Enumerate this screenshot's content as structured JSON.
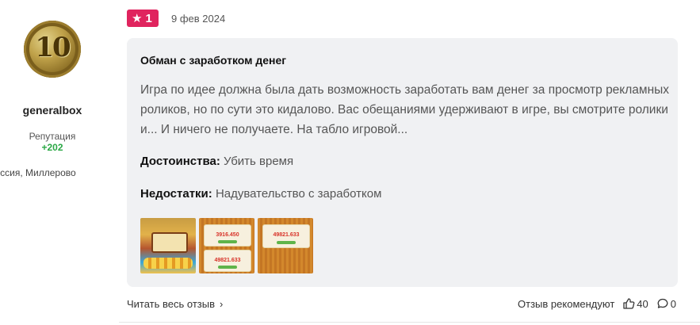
{
  "author": {
    "avatar_text": "10",
    "username": "generalbox",
    "reputation_label": "Репутация",
    "reputation_value": "+202",
    "location": "Россия, Миллерово"
  },
  "review": {
    "rating_badge": "1",
    "date": "9 фев 2024",
    "title": "Обман с заработком денег",
    "body": "Игра по идее должна была дать возможность заработать вам денег за просмотр рекламных роликов, но по сути это кидалово. Вас обещаниями удерживают в игре, вы смотрите ролики и... И ничего не получаете. На табло игровой...",
    "pros_label": "Достоинства:",
    "pros_value": "Убить время",
    "cons_label": "Недостатки:",
    "cons_value": "Надувательство с заработком",
    "thumbnails": [
      {
        "name": "game-screenshot-1"
      },
      {
        "name": "game-screenshot-2",
        "numbers": [
          "3916.450",
          "49821.633"
        ]
      },
      {
        "name": "game-screenshot-3",
        "numbers": [
          "49821.633"
        ]
      }
    ]
  },
  "footer": {
    "read_full": "Читать весь отзыв",
    "recommend_label": "Отзыв рекомендуют",
    "likes": "40",
    "comments": "0"
  },
  "colors": {
    "badge": "#e0245e",
    "reputation": "#2aa845",
    "card_bg": "#f0f1f3"
  }
}
